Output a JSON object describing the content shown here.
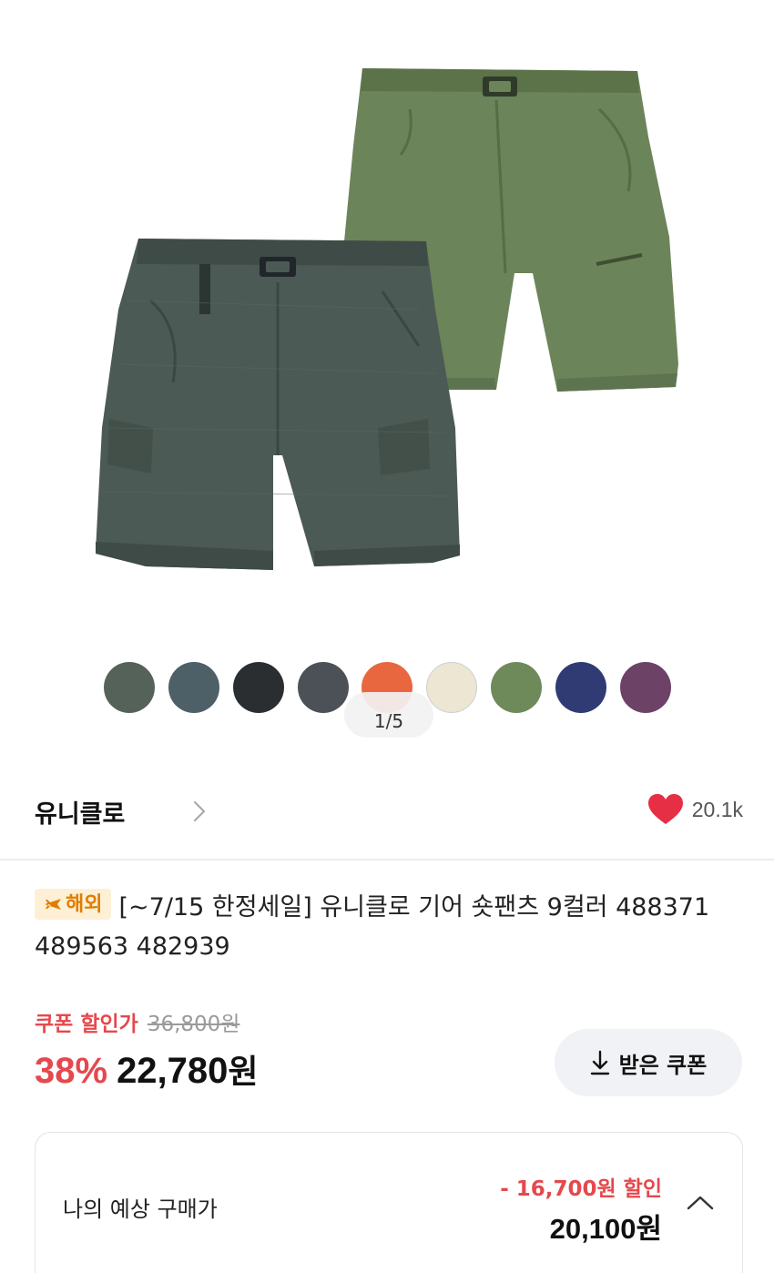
{
  "gallery": {
    "pager": "1/5",
    "swatches": [
      {
        "name": "dark-gray-green",
        "color": "#55625a"
      },
      {
        "name": "blue-gray",
        "color": "#4d5f67"
      },
      {
        "name": "charcoal",
        "color": "#2b2e31"
      },
      {
        "name": "gray",
        "color": "#4b5157"
      },
      {
        "name": "orange",
        "color": "#e8673f"
      },
      {
        "name": "cream",
        "color": "#ece6d3"
      },
      {
        "name": "olive",
        "color": "#6f8a5a"
      },
      {
        "name": "navy",
        "color": "#2f3b72"
      },
      {
        "name": "purple",
        "color": "#6d4267"
      }
    ]
  },
  "brand": {
    "name": "유니클로",
    "likes": "20.1k",
    "heart_color": "#e62e45"
  },
  "product": {
    "badge": "해외",
    "title": "[~7/15 한정세일] 유니클로 기어 숏팬츠 9컬러 488371 489563 482939"
  },
  "price": {
    "coupon_label": "쿠폰 할인가",
    "original": "36,800원",
    "discount_rate": "38%",
    "sale_amount": "22,780",
    "sale_unit": "원",
    "coupon_button": "받은 쿠폰",
    "accent_color": "#e5484d"
  },
  "expected": {
    "label": "나의 예상 구매가",
    "discount": "- 16,700원 할인",
    "final_amount": "20,100",
    "final_unit": "원"
  }
}
